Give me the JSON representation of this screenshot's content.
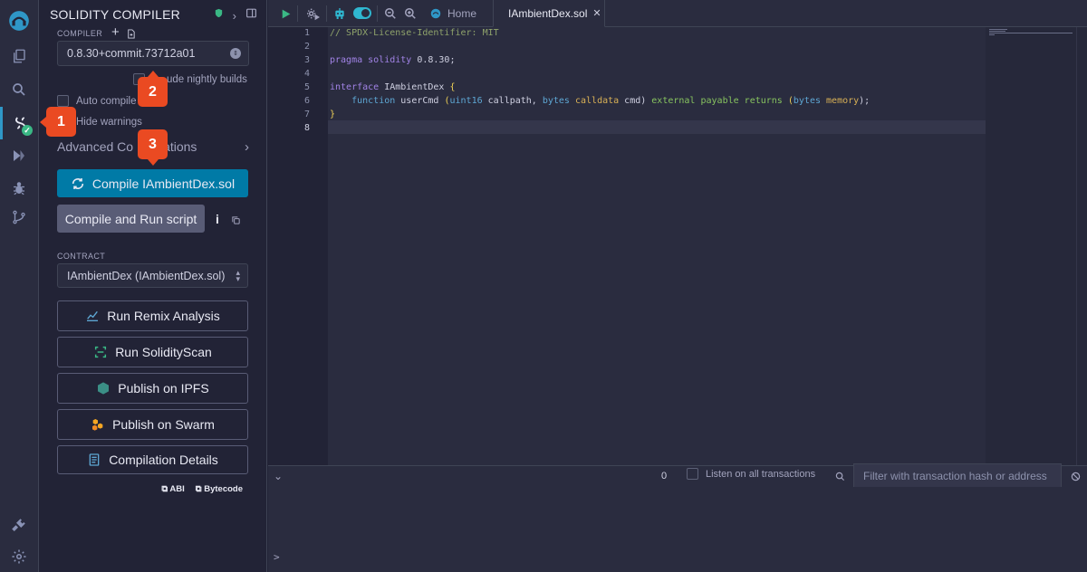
{
  "panel": {
    "title": "SOLIDITY COMPILER",
    "compiler_label": "COMPILER",
    "compiler_version": "0.8.30+commit.73712a01",
    "include_nightly": "Include nightly builds",
    "include_nightly_visible": "ude nightly builds",
    "auto_compile": "Auto compile",
    "hide_warnings": "Hide warnings",
    "advanced": "Advanced Configurations",
    "advanced_prefix": "Advanced Co",
    "advanced_suffix": "ations",
    "compile_button": "Compile IAmbientDex.sol",
    "compile_run_button": "Compile and Run script",
    "info_icon_glyph": "i",
    "contract_label": "CONTRACT",
    "contract_value": "IAmbientDex (IAmbientDex.sol)",
    "run_remix_analysis": "Run Remix Analysis",
    "run_solidityscan": "Run SolidityScan",
    "publish_ipfs": "Publish on IPFS",
    "publish_swarm": "Publish on Swarm",
    "compilation_details": "Compilation Details",
    "abi": "ABI",
    "bytecode": "Bytecode"
  },
  "callouts": [
    "1",
    "2",
    "3"
  ],
  "topbar": {
    "home_tab": "Home",
    "file_tab": "IAmbientDex.sol",
    "close_glyph": "✕"
  },
  "editor": {
    "line_numbers": [
      "1",
      "2",
      "3",
      "4",
      "5",
      "6",
      "7",
      "8"
    ],
    "lines": {
      "l1_comment": "// SPDX-License-Identifier: MIT",
      "l3_pragma": "pragma solidity",
      "l3_version": " 0.8.30;",
      "l5_interface": "interface",
      "l5_name": " IAmbientDex ",
      "l5_brace": "{",
      "l6_indent": "    ",
      "l6_function": "function",
      "l6_name": " userCmd ",
      "l6_paren_open": "(",
      "l6_uint16": "uint16",
      "l6_callpath": " callpath, ",
      "l6_bytes1": "bytes",
      "l6_space1": " ",
      "l6_calldata": "calldata",
      "l6_cmd": " cmd) ",
      "l6_external": "external",
      "l6_space2": " ",
      "l6_payable": "payable",
      "l6_space3": " ",
      "l6_returns": "returns",
      "l6_space4": " ",
      "l6_paren_open2": "(",
      "l6_bytes2": "bytes",
      "l6_space5": " ",
      "l6_memory": "memory",
      "l6_end": ");",
      "l7_brace": "}"
    }
  },
  "terminal": {
    "count": "0",
    "listen": "Listen on all transactions",
    "filter_placeholder": "Filter with transaction hash or address",
    "prompt": ">"
  },
  "colors": {
    "accent": "#007aa6",
    "callout": "#ea4a22",
    "success": "#3ab885"
  }
}
